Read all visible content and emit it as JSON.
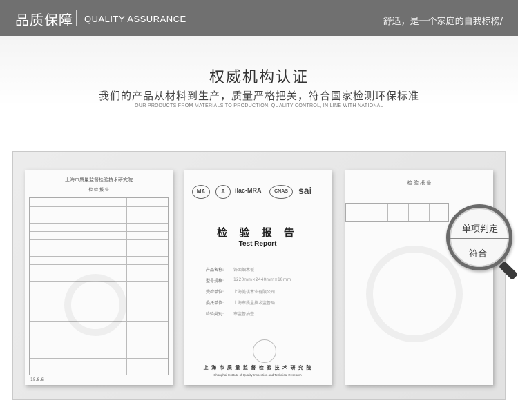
{
  "header": {
    "cn_title": "品质保障",
    "en_title": "QUALITY ASSURANCE",
    "slogan": "舒适，是一个家庭的自我标榜/"
  },
  "intro": {
    "title": "权威机构认证",
    "subtitle": "我们的产品从材料到生产，质量严格把关，符合国家检测环保标准",
    "subtitle_en": "OUR PRODUCTS FROM MATERIALS TO PRODUCTION, QUALITY CONTROL, IN LINE WITH NATIONAL"
  },
  "doc1": {
    "header_a": "上海市质量监督检验技术研究院",
    "header_b": "检 验 报 告",
    "footer": "15.8.6"
  },
  "doc2": {
    "logos": [
      "MA",
      "A",
      "ilac-MRA",
      "CNAS",
      "sai"
    ],
    "title": "检 验 报 告",
    "subtitle": "Test Report",
    "fields": [
      {
        "label": "产品名称:",
        "value": "饰面细木板"
      },
      {
        "label": "型号规格:",
        "value": "1220mm×2440mm×18mm"
      },
      {
        "label": "受检单位:",
        "value": "上海美琪木业有限公司"
      },
      {
        "label": "委托单位:",
        "value": "上海市质量技术监督局"
      },
      {
        "label": "检验类别:",
        "value": "市监督抽查"
      }
    ],
    "institute_cn": "上 海 市 质 量 监 督 检 验 技 术 研 究 院",
    "institute_en": "Shanghai Institute of Quality Inspection and Technical Research"
  },
  "doc3": {
    "header_a": "检 验 报 告",
    "magnified_label": "单项判定",
    "magnified_value": "符合"
  }
}
